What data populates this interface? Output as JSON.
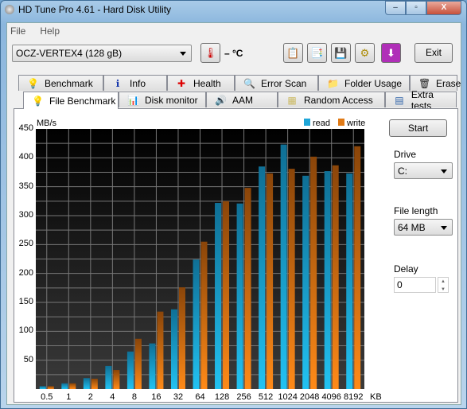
{
  "window": {
    "title": "HD Tune Pro 4.61 - Hard Disk Utility",
    "minimize": "–",
    "maximize": "▫",
    "close": "X"
  },
  "menu": {
    "file": "File",
    "help": "Help"
  },
  "toolbar": {
    "drive": "OCZ-VERTEX4 (128 gB)",
    "temperature": "– °C",
    "exit": "Exit",
    "icons": [
      "copy-info-icon",
      "copy-screenshot-icon",
      "save-icon",
      "options-icon",
      "download-icon"
    ]
  },
  "tabs_row1": [
    "Benchmark",
    "Info",
    "Health",
    "Error Scan",
    "Folder Usage",
    "Erase"
  ],
  "tabs_row2": [
    "File Benchmark",
    "Disk monitor",
    "AAM",
    "Random Access",
    "Extra tests"
  ],
  "active_tab": "File Benchmark",
  "side": {
    "start": "Start",
    "drive_label": "Drive",
    "drive_value": "C:",
    "file_length_label": "File length",
    "file_length_value": "64 MB",
    "delay_label": "Delay",
    "delay_value": "0"
  },
  "colors": {
    "read": "#1fa6d8",
    "write": "#e07a16",
    "plot_bg": "#111111"
  },
  "chart_data": {
    "type": "bar",
    "ylabel": "MB/s",
    "xunit": "KB",
    "ylim": [
      0,
      450
    ],
    "yticks": [
      50,
      100,
      150,
      200,
      250,
      300,
      350,
      400,
      450
    ],
    "grid": true,
    "legend": "top-right",
    "categories": [
      "0.5",
      "1",
      "2",
      "4",
      "8",
      "16",
      "32",
      "64",
      "128",
      "256",
      "512",
      "1024",
      "2048",
      "4096",
      "8192"
    ],
    "series": [
      {
        "name": "read",
        "values": [
          5,
          10,
          19,
          40,
          65,
          79,
          138,
          224,
          322,
          321,
          385,
          423,
          369,
          377,
          373
        ]
      },
      {
        "name": "write",
        "values": [
          5,
          10,
          18,
          33,
          87,
          134,
          176,
          255,
          325,
          348,
          373,
          381,
          402,
          387,
          420
        ]
      }
    ]
  }
}
